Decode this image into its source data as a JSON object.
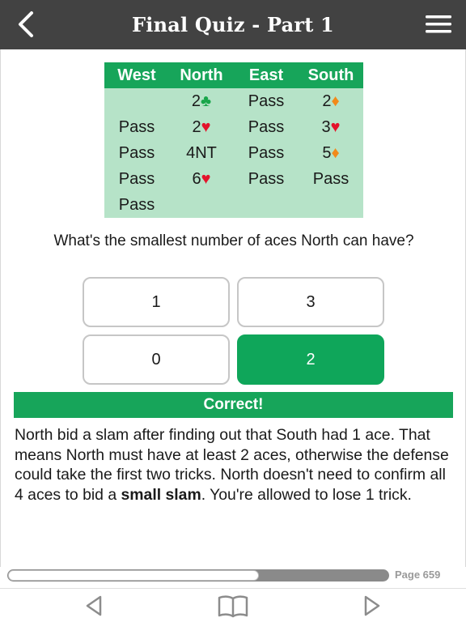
{
  "header": {
    "title": "Final Quiz - Part 1",
    "back_icon": "chevron-left-icon",
    "menu_icon": "hamburger-menu-icon"
  },
  "bidding": {
    "headers": [
      "West",
      "North",
      "East",
      "South"
    ],
    "rows": [
      [
        {
          "text": ""
        },
        {
          "text": "2",
          "suit": "♣",
          "suit_color": "green"
        },
        {
          "text": "Pass"
        },
        {
          "text": "2",
          "suit": "♦",
          "suit_color": "orange"
        }
      ],
      [
        {
          "text": "Pass"
        },
        {
          "text": "2",
          "suit": "♥",
          "suit_color": "red"
        },
        {
          "text": "Pass"
        },
        {
          "text": "3",
          "suit": "♥",
          "suit_color": "red"
        }
      ],
      [
        {
          "text": "Pass"
        },
        {
          "text": "4NT"
        },
        {
          "text": "Pass"
        },
        {
          "text": "5",
          "suit": "♦",
          "suit_color": "orange"
        }
      ],
      [
        {
          "text": "Pass"
        },
        {
          "text": "6",
          "suit": "♥",
          "suit_color": "red"
        },
        {
          "text": "Pass"
        },
        {
          "text": "Pass"
        }
      ],
      [
        {
          "text": "Pass"
        },
        {
          "text": ""
        },
        {
          "text": ""
        },
        {
          "text": ""
        }
      ]
    ]
  },
  "question": "What's the smallest number of aces North can have?",
  "answers": [
    {
      "label": "1",
      "selected": false
    },
    {
      "label": "3",
      "selected": false
    },
    {
      "label": "0",
      "selected": false
    },
    {
      "label": "2",
      "selected": true
    }
  ],
  "feedback": "Correct!",
  "explanation": {
    "text_before": "North bid a slam after finding out that South had 1 ace. That means North must have at least 2 aces, otherwise the defense could take the first two tricks. North doesn't need to confirm all 4 aces to bid a ",
    "bold": "small slam",
    "text_after": ". You're allowed to lose 1 trick."
  },
  "progress": {
    "fraction": 0.66,
    "page_label": "Page 659"
  },
  "nav": {
    "prev_icon": "triangle-left-icon",
    "book_icon": "open-book-icon",
    "next_icon": "triangle-right-icon"
  },
  "colors": {
    "header_bg": "#424242",
    "accent_green": "#17a55a",
    "table_bg": "#b6e3c8",
    "heart_red": "#e3132b",
    "diamond_orange": "#f28a1a",
    "club_green": "#18a64a"
  }
}
